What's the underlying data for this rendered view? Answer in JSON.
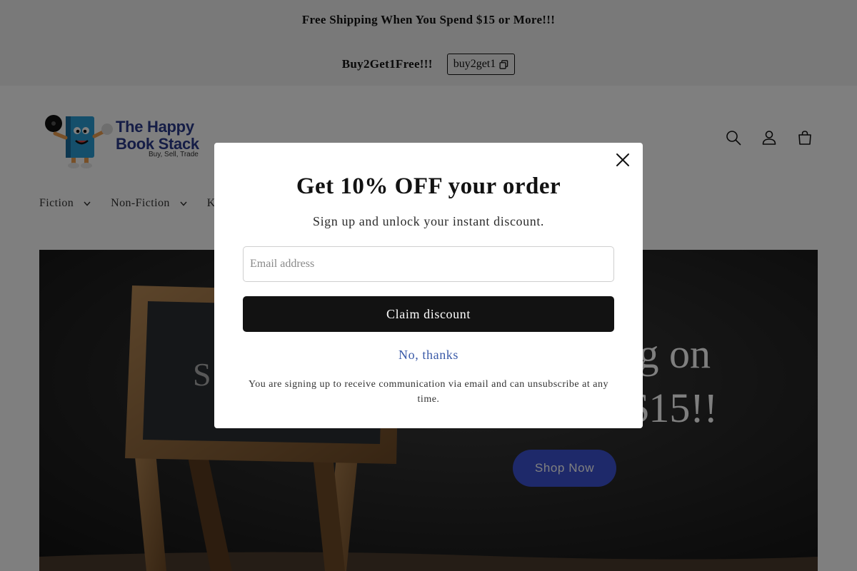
{
  "announcement": {
    "line1": "Free Shipping When You Spend $15 or More!!!",
    "promo_text": "Buy2Get1Free!!!",
    "promo_code": "buy2get1",
    "copy_icon": "copy-icon"
  },
  "header": {
    "logo": {
      "line1": "The Happy",
      "line2": "Book Stack",
      "tagline": "Buy, Sell, Trade"
    },
    "icons": [
      "search-icon",
      "account-icon",
      "cart-icon"
    ],
    "nav": [
      {
        "label": "Fiction",
        "icon": "chevron-down-icon"
      },
      {
        "label": "Non-Fiction",
        "icon": "chevron-down-icon"
      },
      {
        "label": "Kids",
        "icon": "chevron-down-icon"
      }
    ]
  },
  "hero": {
    "heading_line1": "g on",
    "heading_line2": "$15!!",
    "chalkboard_text": "S",
    "button_label": "Shop Now",
    "button_color": "#3d52d5"
  },
  "modal": {
    "title": "Get 10% OFF your order",
    "subtitle": "Sign up and unlock your instant discount.",
    "email_placeholder": "Email address",
    "claim_label": "Claim discount",
    "no_thanks_label": "No, thanks",
    "disclaimer": "You are signing up to receive communication via email and can unsubscribe at any time.",
    "close_icon": "close-icon",
    "link_color": "#3a5aa8"
  }
}
